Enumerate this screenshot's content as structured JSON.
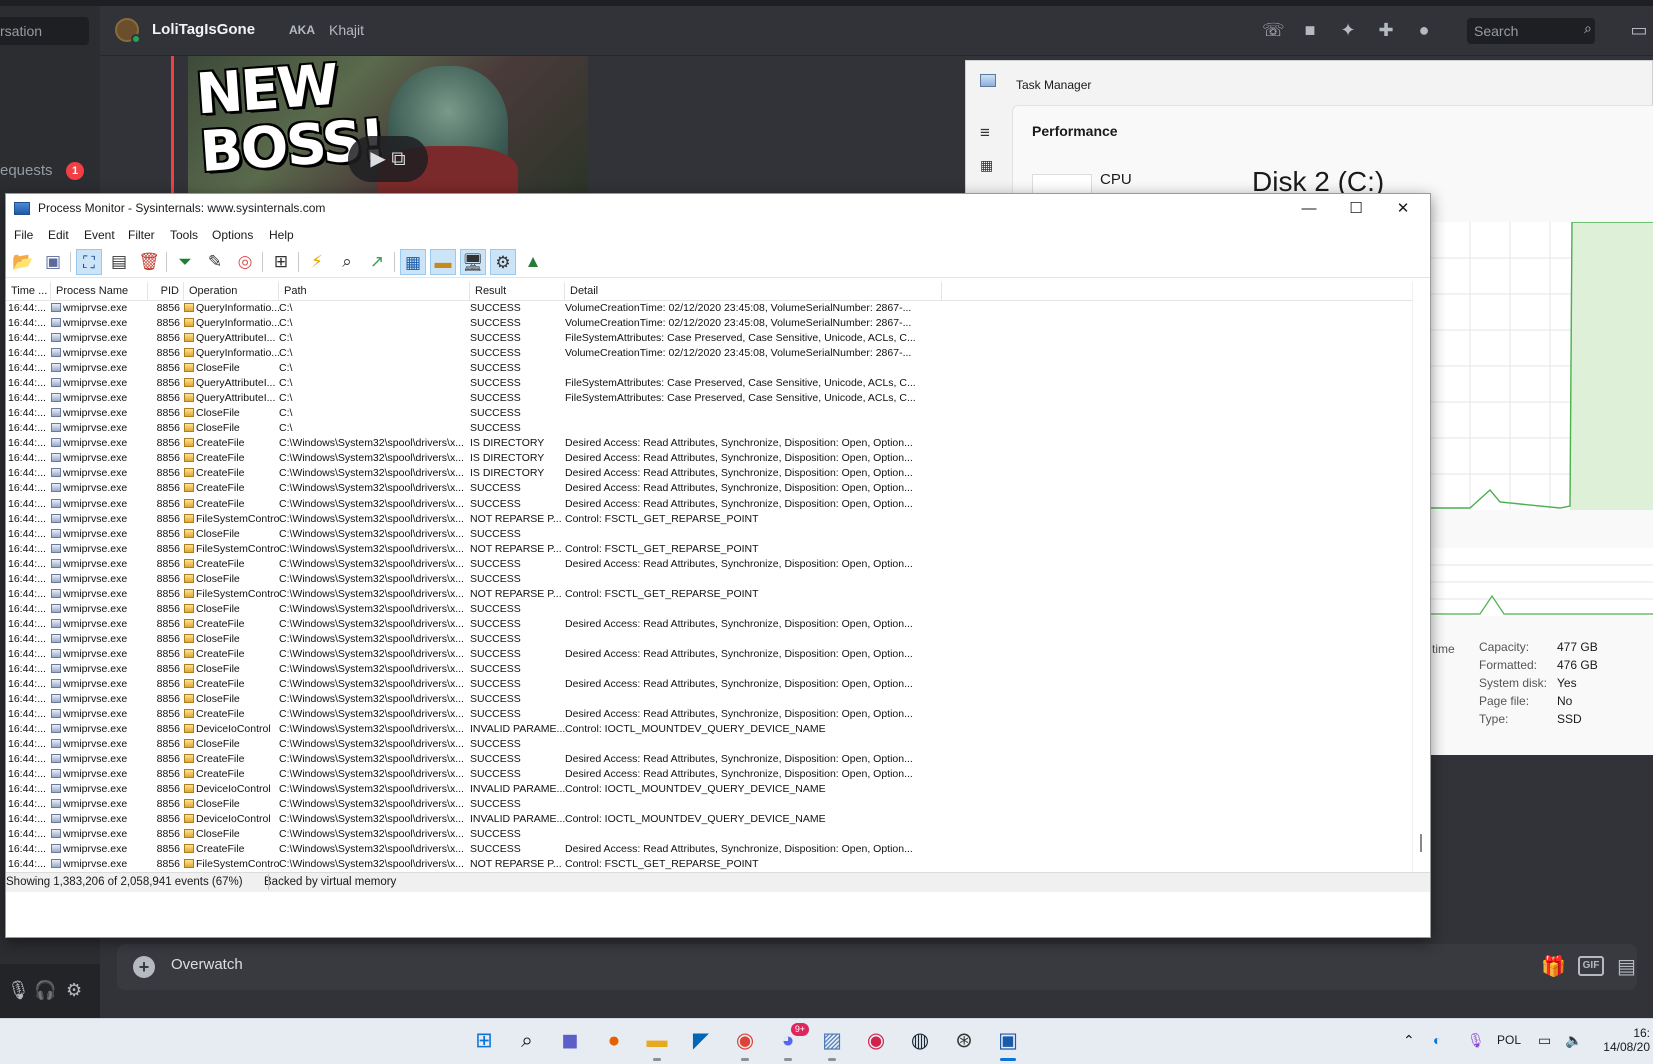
{
  "discord": {
    "search_conversation": "rsation",
    "friend_name": "LoliTagIsGone",
    "aka_label": "AKA",
    "alias": "Khajit",
    "search_placeholder": "Search",
    "requests_label": "equests",
    "requests_count": "1",
    "video_text_line1": "NEW",
    "video_text_line2": "BOSS!",
    "message_input_text": "Overwatch",
    "gif_label": "GIF"
  },
  "task_manager": {
    "title": "Task Manager",
    "section": "Performance",
    "cpu_label": "CPU",
    "disk_title": "Disk 2 (C:)",
    "time_label": "time",
    "props": [
      {
        "label": "Capacity:",
        "value": "477 GB"
      },
      {
        "label": "Formatted:",
        "value": "476 GB"
      },
      {
        "label": "System disk:",
        "value": "Yes"
      },
      {
        "label": "Page file:",
        "value": "No"
      },
      {
        "label": "Type:",
        "value": "SSD"
      }
    ]
  },
  "procmon": {
    "title": "Process Monitor - Sysinternals: www.sysinternals.com",
    "menu": [
      "File",
      "Edit",
      "Event",
      "Filter",
      "Tools",
      "Options",
      "Help"
    ],
    "columns": [
      "Time ...",
      "Process Name",
      "PID",
      "Operation",
      "Path",
      "Result",
      "Detail"
    ],
    "rows": [
      [
        "16:44:...",
        "wmiprvse.exe",
        "8856",
        "QueryInformatio...",
        "C:\\",
        "SUCCESS",
        "VolumeCreationTime: 02/12/2020 23:45:08, VolumeSerialNumber: 2867-..."
      ],
      [
        "16:44:...",
        "wmiprvse.exe",
        "8856",
        "QueryInformatio...",
        "C:\\",
        "SUCCESS",
        "VolumeCreationTime: 02/12/2020 23:45:08, VolumeSerialNumber: 2867-..."
      ],
      [
        "16:44:...",
        "wmiprvse.exe",
        "8856",
        "QueryAttributeI...",
        "C:\\",
        "SUCCESS",
        "FileSystemAttributes: Case Preserved, Case Sensitive, Unicode, ACLs, C..."
      ],
      [
        "16:44:...",
        "wmiprvse.exe",
        "8856",
        "QueryInformatio...",
        "C:\\",
        "SUCCESS",
        "VolumeCreationTime: 02/12/2020 23:45:08, VolumeSerialNumber: 2867-..."
      ],
      [
        "16:44:...",
        "wmiprvse.exe",
        "8856",
        "CloseFile",
        "C:\\",
        "SUCCESS",
        ""
      ],
      [
        "16:44:...",
        "wmiprvse.exe",
        "8856",
        "QueryAttributeI...",
        "C:\\",
        "SUCCESS",
        "FileSystemAttributes: Case Preserved, Case Sensitive, Unicode, ACLs, C..."
      ],
      [
        "16:44:...",
        "wmiprvse.exe",
        "8856",
        "QueryAttributeI...",
        "C:\\",
        "SUCCESS",
        "FileSystemAttributes: Case Preserved, Case Sensitive, Unicode, ACLs, C..."
      ],
      [
        "16:44:...",
        "wmiprvse.exe",
        "8856",
        "CloseFile",
        "C:\\",
        "SUCCESS",
        ""
      ],
      [
        "16:44:...",
        "wmiprvse.exe",
        "8856",
        "CloseFile",
        "C:\\",
        "SUCCESS",
        ""
      ],
      [
        "16:44:...",
        "wmiprvse.exe",
        "8856",
        "CreateFile",
        "C:\\Windows\\System32\\spool\\drivers\\x...",
        "IS DIRECTORY",
        "Desired Access: Read Attributes, Synchronize, Disposition: Open, Option..."
      ],
      [
        "16:44:...",
        "wmiprvse.exe",
        "8856",
        "CreateFile",
        "C:\\Windows\\System32\\spool\\drivers\\x...",
        "IS DIRECTORY",
        "Desired Access: Read Attributes, Synchronize, Disposition: Open, Option..."
      ],
      [
        "16:44:...",
        "wmiprvse.exe",
        "8856",
        "CreateFile",
        "C:\\Windows\\System32\\spool\\drivers\\x...",
        "IS DIRECTORY",
        "Desired Access: Read Attributes, Synchronize, Disposition: Open, Option..."
      ],
      [
        "16:44:...",
        "wmiprvse.exe",
        "8856",
        "CreateFile",
        "C:\\Windows\\System32\\spool\\drivers\\x...",
        "SUCCESS",
        "Desired Access: Read Attributes, Synchronize, Disposition: Open, Option..."
      ],
      [
        "16:44:...",
        "wmiprvse.exe",
        "8856",
        "CreateFile",
        "C:\\Windows\\System32\\spool\\drivers\\x...",
        "SUCCESS",
        "Desired Access: Read Attributes, Synchronize, Disposition: Open, Option..."
      ],
      [
        "16:44:...",
        "wmiprvse.exe",
        "8856",
        "FileSystemControl",
        "C:\\Windows\\System32\\spool\\drivers\\x...",
        "NOT REPARSE P...",
        "Control: FSCTL_GET_REPARSE_POINT"
      ],
      [
        "16:44:...",
        "wmiprvse.exe",
        "8856",
        "CloseFile",
        "C:\\Windows\\System32\\spool\\drivers\\x...",
        "SUCCESS",
        ""
      ],
      [
        "16:44:...",
        "wmiprvse.exe",
        "8856",
        "FileSystemControl",
        "C:\\Windows\\System32\\spool\\drivers\\x...",
        "NOT REPARSE P...",
        "Control: FSCTL_GET_REPARSE_POINT"
      ],
      [
        "16:44:...",
        "wmiprvse.exe",
        "8856",
        "CreateFile",
        "C:\\Windows\\System32\\spool\\drivers\\x...",
        "SUCCESS",
        "Desired Access: Read Attributes, Synchronize, Disposition: Open, Option..."
      ],
      [
        "16:44:...",
        "wmiprvse.exe",
        "8856",
        "CloseFile",
        "C:\\Windows\\System32\\spool\\drivers\\x...",
        "SUCCESS",
        ""
      ],
      [
        "16:44:...",
        "wmiprvse.exe",
        "8856",
        "FileSystemControl",
        "C:\\Windows\\System32\\spool\\drivers\\x...",
        "NOT REPARSE P...",
        "Control: FSCTL_GET_REPARSE_POINT"
      ],
      [
        "16:44:...",
        "wmiprvse.exe",
        "8856",
        "CloseFile",
        "C:\\Windows\\System32\\spool\\drivers\\x...",
        "SUCCESS",
        ""
      ],
      [
        "16:44:...",
        "wmiprvse.exe",
        "8856",
        "CreateFile",
        "C:\\Windows\\System32\\spool\\drivers\\x...",
        "SUCCESS",
        "Desired Access: Read Attributes, Synchronize, Disposition: Open, Option..."
      ],
      [
        "16:44:...",
        "wmiprvse.exe",
        "8856",
        "CloseFile",
        "C:\\Windows\\System32\\spool\\drivers\\x...",
        "SUCCESS",
        ""
      ],
      [
        "16:44:...",
        "wmiprvse.exe",
        "8856",
        "CreateFile",
        "C:\\Windows\\System32\\spool\\drivers\\x...",
        "SUCCESS",
        "Desired Access: Read Attributes, Synchronize, Disposition: Open, Option..."
      ],
      [
        "16:44:...",
        "wmiprvse.exe",
        "8856",
        "CloseFile",
        "C:\\Windows\\System32\\spool\\drivers\\x...",
        "SUCCESS",
        ""
      ],
      [
        "16:44:...",
        "wmiprvse.exe",
        "8856",
        "CreateFile",
        "C:\\Windows\\System32\\spool\\drivers\\x...",
        "SUCCESS",
        "Desired Access: Read Attributes, Synchronize, Disposition: Open, Option..."
      ],
      [
        "16:44:...",
        "wmiprvse.exe",
        "8856",
        "CloseFile",
        "C:\\Windows\\System32\\spool\\drivers\\x...",
        "SUCCESS",
        ""
      ],
      [
        "16:44:...",
        "wmiprvse.exe",
        "8856",
        "CreateFile",
        "C:\\Windows\\System32\\spool\\drivers\\x...",
        "SUCCESS",
        "Desired Access: Read Attributes, Synchronize, Disposition: Open, Option..."
      ],
      [
        "16:44:...",
        "wmiprvse.exe",
        "8856",
        "DeviceIoControl",
        "C:\\Windows\\System32\\spool\\drivers\\x...",
        "INVALID PARAME...",
        "Control: IOCTL_MOUNTDEV_QUERY_DEVICE_NAME"
      ],
      [
        "16:44:...",
        "wmiprvse.exe",
        "8856",
        "CloseFile",
        "C:\\Windows\\System32\\spool\\drivers\\x...",
        "SUCCESS",
        ""
      ],
      [
        "16:44:...",
        "wmiprvse.exe",
        "8856",
        "CreateFile",
        "C:\\Windows\\System32\\spool\\drivers\\x...",
        "SUCCESS",
        "Desired Access: Read Attributes, Synchronize, Disposition: Open, Option..."
      ],
      [
        "16:44:...",
        "wmiprvse.exe",
        "8856",
        "CreateFile",
        "C:\\Windows\\System32\\spool\\drivers\\x...",
        "SUCCESS",
        "Desired Access: Read Attributes, Synchronize, Disposition: Open, Option..."
      ],
      [
        "16:44:...",
        "wmiprvse.exe",
        "8856",
        "DeviceIoControl",
        "C:\\Windows\\System32\\spool\\drivers\\x...",
        "INVALID PARAME...",
        "Control: IOCTL_MOUNTDEV_QUERY_DEVICE_NAME"
      ],
      [
        "16:44:...",
        "wmiprvse.exe",
        "8856",
        "CloseFile",
        "C:\\Windows\\System32\\spool\\drivers\\x...",
        "SUCCESS",
        ""
      ],
      [
        "16:44:...",
        "wmiprvse.exe",
        "8856",
        "DeviceIoControl",
        "C:\\Windows\\System32\\spool\\drivers\\x...",
        "INVALID PARAME...",
        "Control: IOCTL_MOUNTDEV_QUERY_DEVICE_NAME"
      ],
      [
        "16:44:...",
        "wmiprvse.exe",
        "8856",
        "CloseFile",
        "C:\\Windows\\System32\\spool\\drivers\\x...",
        "SUCCESS",
        ""
      ],
      [
        "16:44:...",
        "wmiprvse.exe",
        "8856",
        "CreateFile",
        "C:\\Windows\\System32\\spool\\drivers\\x...",
        "SUCCESS",
        "Desired Access: Read Attributes, Synchronize, Disposition: Open, Option..."
      ],
      [
        "16:44:...",
        "wmiprvse.exe",
        "8856",
        "FileSystemControl",
        "C:\\Windows\\System32\\spool\\drivers\\x...",
        "NOT REPARSE P...",
        "Control: FSCTL_GET_REPARSE_POINT"
      ],
      [
        "16:44:...",
        "wmiprvse.exe",
        "8856",
        "CloseFile",
        "C:\\Windows\\System32\\spool\\drivers\\x...",
        "SUCCESS",
        ""
      ],
      [
        "16:44:...",
        "wmiprvse.exe",
        "8856",
        "CreateFile",
        "C:\\Windows\\System32\\spool\\drivers\\x...",
        "SUCCESS",
        "Desired Access: Read Attributes, Synchronize, Disposition: Open, Option..."
      ]
    ],
    "selected_row": 39,
    "status_events": "Showing 1,383,206 of 2,058,941 events (67%)",
    "status_memory": "Backed by virtual memory"
  },
  "taskbar": {
    "discord_badge": "9+",
    "lang": "POL",
    "clock_time": "16:",
    "clock_date": "14/08/20"
  },
  "colors": {
    "selection": "#0078d7",
    "discord_bg": "#313338",
    "graph_line": "#4caf50"
  }
}
